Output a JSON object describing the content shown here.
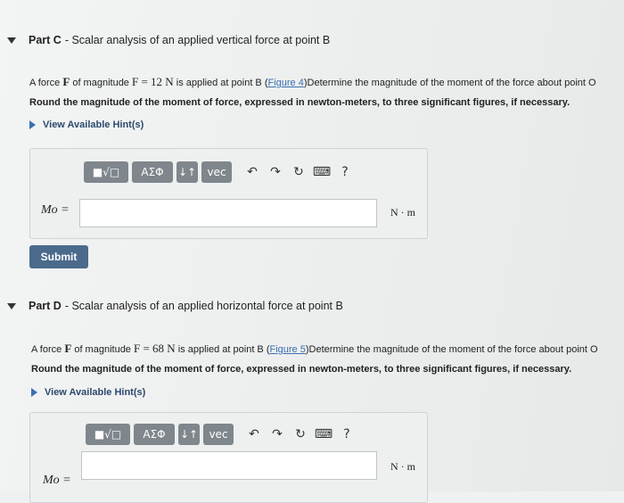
{
  "partC": {
    "label": "Part C",
    "title": "- Scalar analysis of an applied vertical force at point B",
    "text_prefix": "A force",
    "force_symbol": "F",
    "text_mid": "of magnitude",
    "equation": "F = 12 N",
    "text_applied": "is applied at point B (",
    "figure_link": "Figure 4",
    "text_suffix": ")Determine the magnitude of the moment of the force about point O",
    "instruction": "Round the magnitude of the moment of force, expressed in newton-meters, to three significant figures, if necessary.",
    "hint": "View Available Hint(s)",
    "variable": "Mo =",
    "unit": "N · m",
    "submit": "Submit"
  },
  "partD": {
    "label": "Part D",
    "title": "- Scalar analysis of an applied horizontal force at point B",
    "text_prefix": "A force",
    "force_symbol": "F",
    "text_mid": "of magnitude",
    "equation": "F = 68 N",
    "text_applied": "is applied at point B (",
    "figure_link": "Figure 5",
    "text_suffix": ")Determine the magnitude of the moment of the force about point O",
    "instruction": "Round the magnitude of the moment of force, expressed in newton-meters, to three significant figures, if necessary.",
    "hint": "View Available Hint(s)",
    "variable": "Mo =",
    "unit": "N · m"
  },
  "toolbar": {
    "template": "■√□",
    "greek": "ΑΣΦ",
    "arrows": "↓↑",
    "vec": "vec",
    "undo": "↶",
    "redo": "↷",
    "reset": "↻",
    "keyboard": "⌨",
    "help": "?"
  }
}
